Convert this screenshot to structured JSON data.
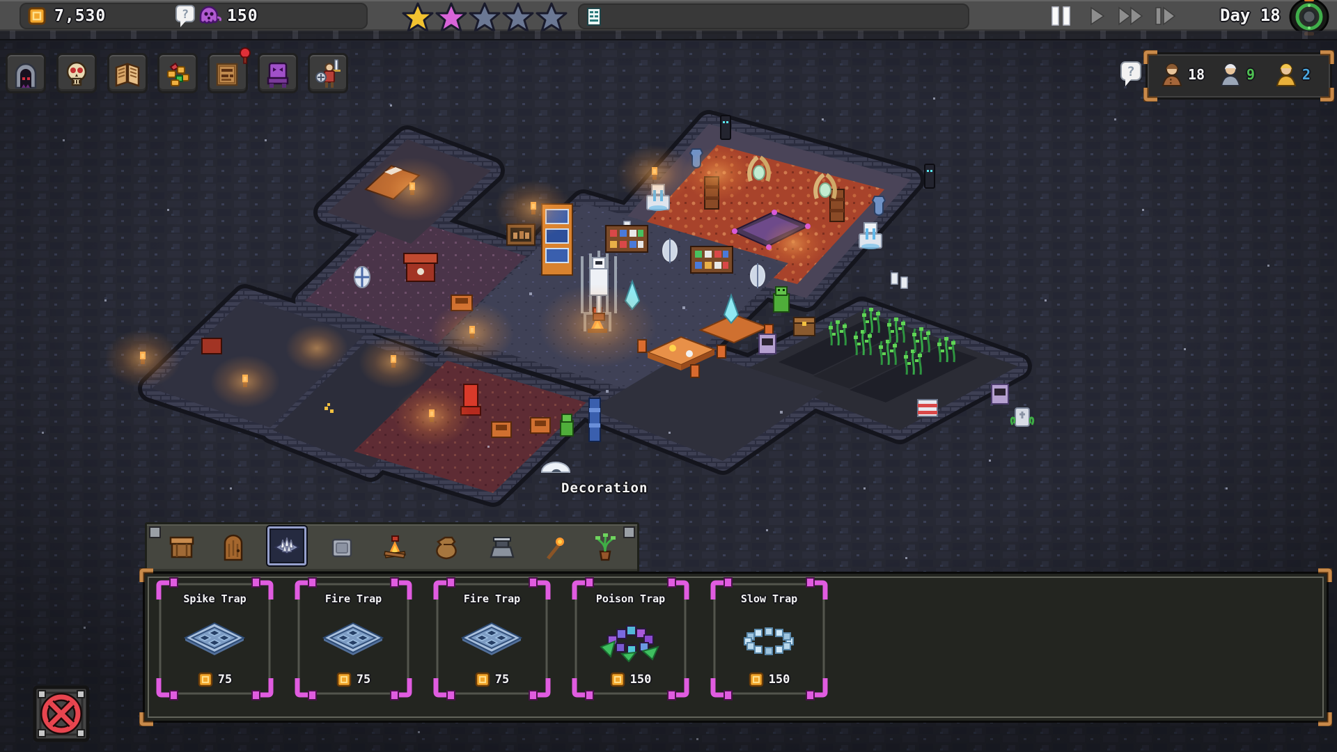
{
  "top_bar": {
    "gold": "7,530",
    "mana": "150",
    "day": "Day 18",
    "stars": [
      "gold",
      "magenta",
      "empty",
      "empty",
      "empty"
    ],
    "icons": [
      "gold-coin-icon",
      "question-bubble-icon",
      "mana-ghost-icon",
      "objective-list-icon",
      "pause-icon",
      "play-icon",
      "fast-forward-icon",
      "step-forward-icon",
      "portal-emblem-icon"
    ]
  },
  "toolbar": {
    "buttons": [
      {
        "icon": "dungeon-gate-icon"
      },
      {
        "icon": "skull-icon"
      },
      {
        "icon": "book-icon"
      },
      {
        "icon": "loot-icon"
      },
      {
        "icon": "notice-sign-icon",
        "badge": "red-alert-pin"
      },
      {
        "icon": "dark-throne-icon"
      },
      {
        "icon": "hero-icon"
      }
    ]
  },
  "population": {
    "units": [
      {
        "icon": "worker-unit-icon",
        "count": "18",
        "count_color": "#f2f2f2"
      },
      {
        "icon": "elder-unit-icon",
        "count": "9",
        "count_color": "#4fc052"
      },
      {
        "icon": "gold-unit-icon",
        "count": "2",
        "count_color": "#4aa8e0"
      }
    ]
  },
  "world": {
    "tooltip": "Decoration"
  },
  "build_menu": {
    "tabs": [
      {
        "icon": "crate-icon",
        "selected": false
      },
      {
        "icon": "door-icon",
        "selected": false
      },
      {
        "icon": "spike-trap-tab-icon",
        "selected": true
      },
      {
        "icon": "pressure-plate-icon",
        "selected": false
      },
      {
        "icon": "campfire-icon",
        "selected": false
      },
      {
        "icon": "sack-icon",
        "selected": false
      },
      {
        "icon": "forge-icon",
        "selected": false
      },
      {
        "icon": "torch-icon",
        "selected": false
      },
      {
        "icon": "decoration-plant-icon",
        "selected": false
      }
    ],
    "items": [
      {
        "name": "Spike Trap",
        "price": "75",
        "icon": "trap-plate-icon"
      },
      {
        "name": "Fire Trap",
        "price": "75",
        "icon": "trap-plate-icon"
      },
      {
        "name": "Fire Trap",
        "price": "75",
        "icon": "trap-plate-icon"
      },
      {
        "name": "Poison Trap",
        "price": "150",
        "icon": "poison-trap-icon"
      },
      {
        "name": "Slow Trap",
        "price": "150",
        "icon": "slow-trap-icon"
      }
    ]
  },
  "colors": {
    "gold_accent": "#f2a62c",
    "magenta_frame": "#e05ce0",
    "copper_frame": "#c98a4a",
    "danger_red": "#e8454f",
    "star_gold": "#f2c230",
    "star_magenta": "#d964d9",
    "star_empty": "#6b7894"
  }
}
